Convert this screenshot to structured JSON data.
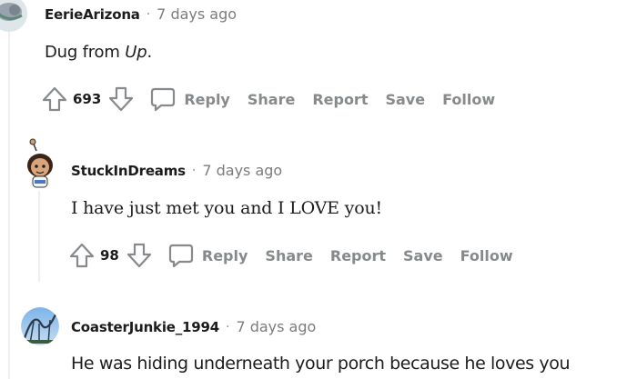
{
  "comments": [
    {
      "username": "EerieArizona",
      "time": "7 days ago",
      "text_plain": "Dug from ",
      "text_italic": "Up",
      "text_end": ".",
      "votes": "693",
      "actions": {
        "reply": "Reply",
        "share": "Share",
        "report": "Report",
        "save": "Save",
        "follow": "Follow"
      }
    },
    {
      "username": "StuckInDreams",
      "time": "7 days ago",
      "text": "I have just met you and I LOVE you!",
      "votes": "98",
      "actions": {
        "reply": "Reply",
        "share": "Share",
        "report": "Report",
        "save": "Save",
        "follow": "Follow"
      }
    },
    {
      "username": "CoasterJunkie_1994",
      "time": "7 days ago",
      "text": "He was hiding underneath your porch because he loves you"
    }
  ],
  "separator": "·",
  "icons": {
    "upvote": "upvote-arrow-icon",
    "downvote": "downvote-arrow-icon",
    "reply": "speech-bubble-icon"
  },
  "colors": {
    "meta_gray": "#878a8c",
    "text": "#1c1c1c",
    "thread_line": "#edeff1"
  }
}
